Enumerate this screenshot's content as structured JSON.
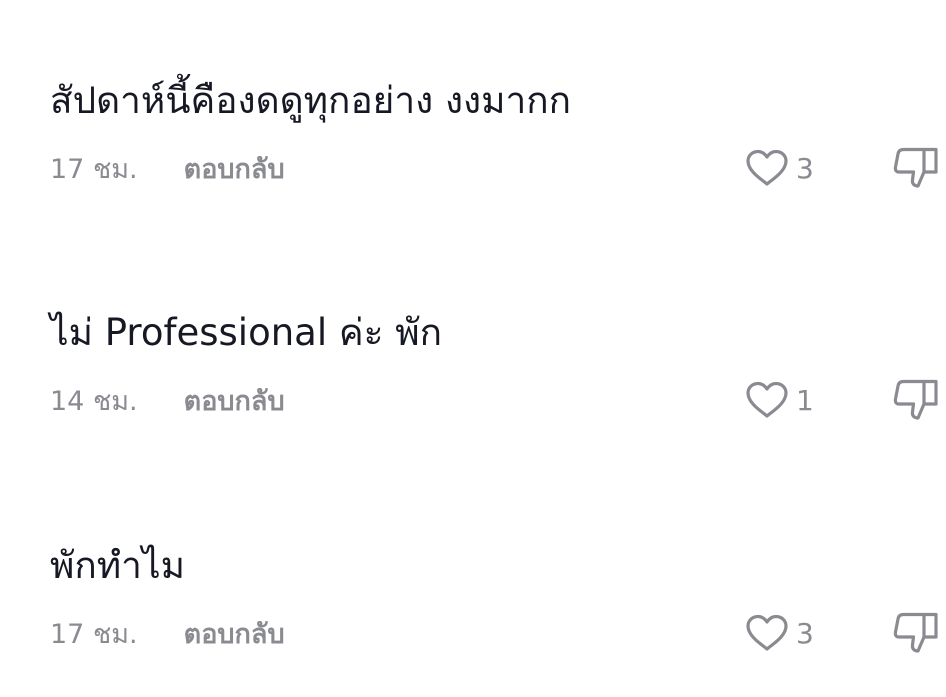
{
  "comments": [
    {
      "text": "สัปดาห์นี้คืองดดูทุกอย่าง งงมากก",
      "time": "17 ชม.",
      "reply_label": "ตอบกลับ",
      "likes": "3"
    },
    {
      "text": "ไม่ Professional ค่ะ พัก",
      "time": "14 ชม.",
      "reply_label": "ตอบกลับ",
      "likes": "1"
    },
    {
      "text": "พักทำไม",
      "time": "17 ชม.",
      "reply_label": "ตอบกลับ",
      "likes": "3"
    }
  ],
  "icons": {
    "like": "heart-outline-icon",
    "dislike": "thumbs-down-icon"
  },
  "colors": {
    "text": "#161823",
    "meta": "#8a8b91",
    "icon": "#8a8b91",
    "background": "#ffffff"
  }
}
